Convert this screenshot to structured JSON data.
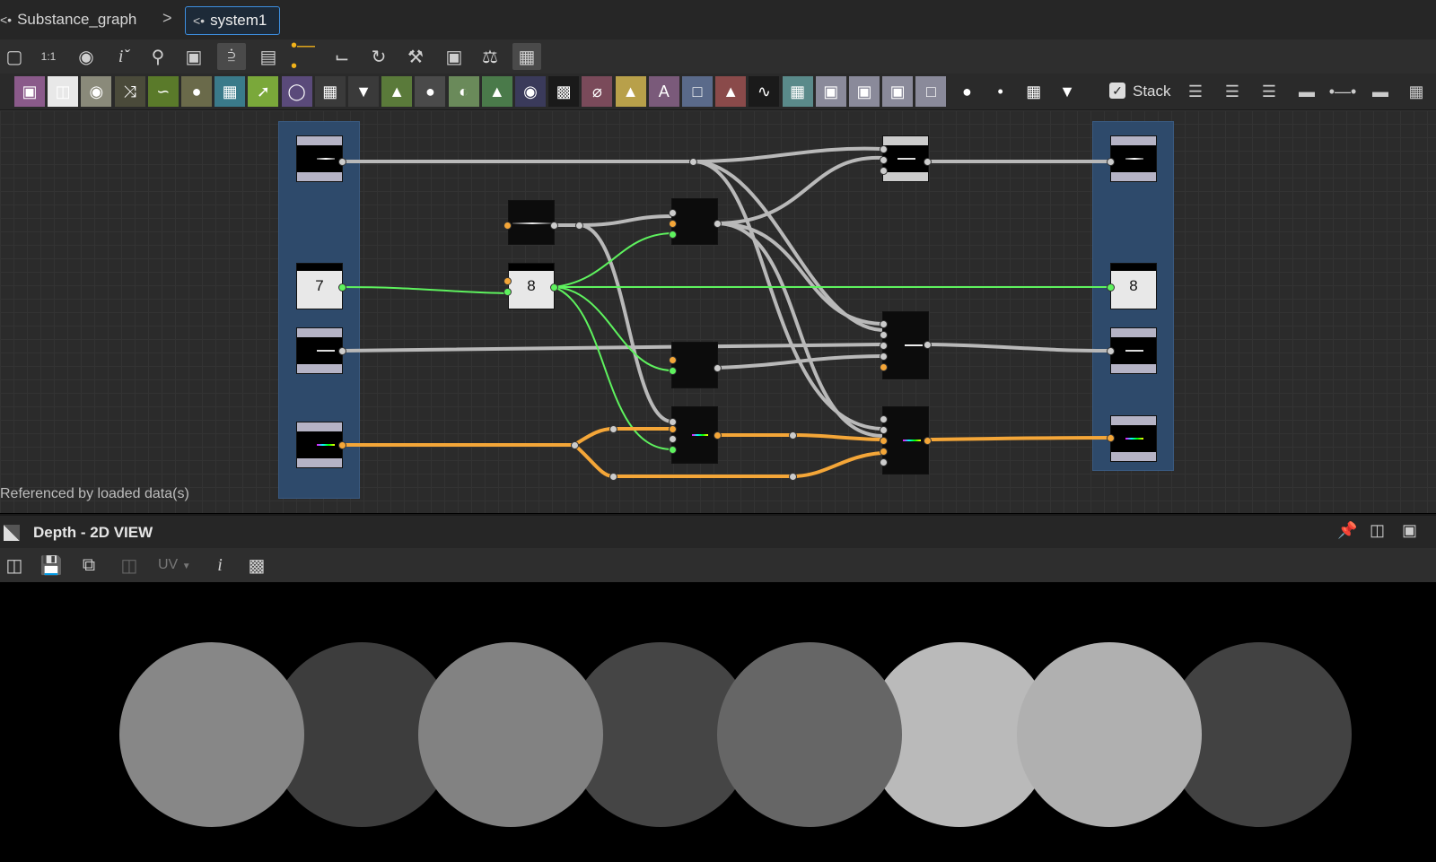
{
  "breadcrumb": {
    "root_label": "Substance_graph",
    "separator": ">",
    "current_tab": "system1"
  },
  "toolbar1": {
    "icons": [
      "fit-view-icon",
      "zoom-1to1-icon",
      "camera-icon",
      "info-icon",
      "search-icon",
      "node-connect-icon",
      "share-graph-icon",
      "frame-icon",
      "link-icon",
      "pipe-icon",
      "refresh-icon",
      "wrench-icon",
      "preview-icon",
      "broom-icon",
      "grid-snap-icon"
    ]
  },
  "toolbar2": {
    "stack_label": "Stack",
    "stack_checked": true,
    "node_icons": [
      {
        "name": "bitmap-node-icon",
        "color": "#8a5a8a"
      },
      {
        "name": "svg-node-icon",
        "color": "#e8e8e8"
      },
      {
        "name": "uniform-color-icon",
        "color": "#8a8a7a"
      },
      {
        "name": "random-icon",
        "color": "#4a4a3a"
      },
      {
        "name": "curve-icon",
        "color": "#5a7a2a"
      },
      {
        "name": "color-drop-icon",
        "color": "#6a6a4a"
      },
      {
        "name": "warp-icon",
        "color": "#3a7a8a"
      },
      {
        "name": "gradient-icon",
        "color": "#7aa83a"
      },
      {
        "name": "circle-node-icon",
        "color": "#5a4a7a"
      },
      {
        "name": "tile-grid-icon",
        "color": "#3a3a3a"
      },
      {
        "name": "blend-down-icon",
        "color": "#3a3a3a"
      },
      {
        "name": "levels-icon",
        "color": "#5a7a3a"
      },
      {
        "name": "toggle-icon",
        "color": "#4a4a4a"
      },
      {
        "name": "contrast-icon",
        "color": "#6a8a5a"
      },
      {
        "name": "histogram-icon",
        "color": "#4a7a4a"
      },
      {
        "name": "hue-wheel-icon",
        "color": "#3a3a5a"
      },
      {
        "name": "noise-01-icon",
        "color": "#1a1a1a"
      },
      {
        "name": "warp-curve-icon",
        "color": "#7a4a5a"
      },
      {
        "name": "mirror-icon",
        "color": "#b8a04a"
      },
      {
        "name": "text-icon",
        "color": "#7a5a7a"
      },
      {
        "name": "transform-icon",
        "color": "#5a6a8a"
      },
      {
        "name": "fill-bucket-icon",
        "color": "#8a4a4a"
      },
      {
        "name": "fx-01-icon",
        "color": "#1a1a1a"
      },
      {
        "name": "normal-map-icon",
        "color": "#5a8a8a"
      },
      {
        "name": "pixel-processor-icon",
        "color": "#8a8a9a"
      },
      {
        "name": "gradient-map-icon",
        "color": "#8a8a9a"
      },
      {
        "name": "fx-map-icon",
        "color": "#8a8a9a"
      },
      {
        "name": "output-node-icon",
        "color": "#8a8a9a"
      },
      {
        "name": "comment-icon",
        "color": "#2a2a2a"
      },
      {
        "name": "dot-node-icon",
        "color": "#2a2a2a"
      },
      {
        "name": "input-node-icon",
        "color": "#2a2a2a"
      },
      {
        "name": "pin-icon",
        "color": "#2a2a2a"
      }
    ],
    "align_icons": [
      "align-left-icon",
      "align-center-icon",
      "align-right-icon",
      "distribute-h-icon",
      "chain-icon",
      "split-icon",
      "layout-icon"
    ]
  },
  "graph": {
    "nodes": {
      "input_number": "7",
      "mid_number": "8",
      "output_number": "8"
    },
    "footer_note": "Referenced by loaded data(s)"
  },
  "view2d": {
    "title": "Depth - 2D VIEW",
    "uv_label": "UV",
    "circle_gray_levels": [
      0.53,
      0.24,
      0.51,
      0.27,
      0.4,
      0.73,
      0.69,
      0.26
    ]
  },
  "colors": {
    "link_gray": "#b9b9b9",
    "link_green": "#5ef25e",
    "link_orange": "#f4a638",
    "frame_blue": "#2e4a6b",
    "tab_accent": "#3d8fe0"
  }
}
